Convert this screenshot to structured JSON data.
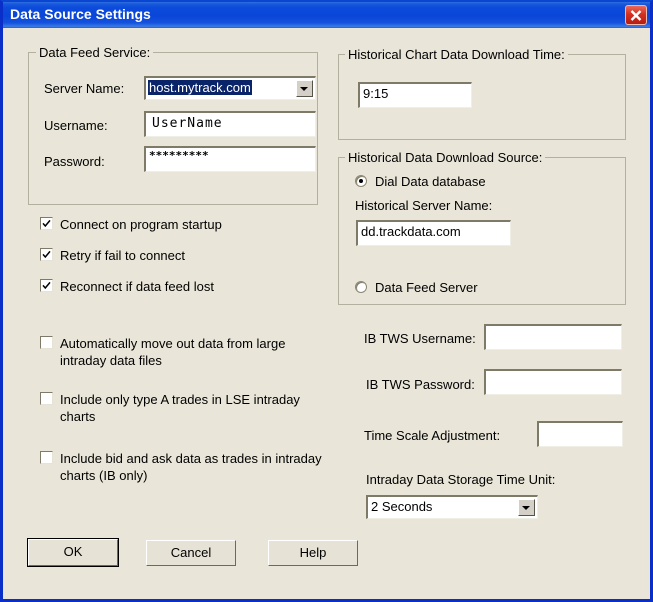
{
  "window": {
    "title": "Data Source Settings",
    "close_icon": "close-icon",
    "accent_color": "#0a46d8",
    "background_color": "#e9e6d9",
    "close_button_color": "#d43022"
  },
  "data_feed_service": {
    "group_title": "Data Feed Service:",
    "server_name_label": "Server Name:",
    "server_name_value": "host.mytrack.com",
    "username_label": "Username:",
    "username_value": "UserName",
    "password_label": "Password:",
    "password_value": "*********"
  },
  "connection_options": [
    {
      "label": "Connect on program startup",
      "checked": true
    },
    {
      "label": "Retry if fail to connect",
      "checked": true
    },
    {
      "label": "Reconnect if data feed lost",
      "checked": true
    }
  ],
  "data_options": [
    {
      "line1": "Automatically move out data from large",
      "line2": "intraday data files",
      "checked": false
    },
    {
      "line1": "Include only type A trades in LSE intraday",
      "line2": "charts",
      "checked": false
    },
    {
      "line1": "Include bid and ask data as trades in intraday",
      "line2": "charts (IB only)",
      "checked": false
    }
  ],
  "historical_chart_time": {
    "group_title": "Historical Chart Data Download Time:",
    "value": "9:15"
  },
  "historical_source": {
    "group_title": "Historical Data Download Source:",
    "option_dial_data": "Dial Data database",
    "option_data_feed": "Data Feed Server",
    "selected": "Dial Data database",
    "server_name_label": "Historical Server Name:",
    "server_name_value": "dd.trackdata.com"
  },
  "ib_tws": {
    "username_label": "IB TWS Username:",
    "username_value": "",
    "password_label": "IB TWS Password:",
    "password_value": "",
    "time_scale_label": "Time Scale Adjustment:",
    "time_scale_value": ""
  },
  "storage_unit": {
    "label": "Intraday Data Storage Time Unit:",
    "value": "2 Seconds"
  },
  "buttons": {
    "ok": "OK",
    "cancel": "Cancel",
    "help": "Help"
  }
}
